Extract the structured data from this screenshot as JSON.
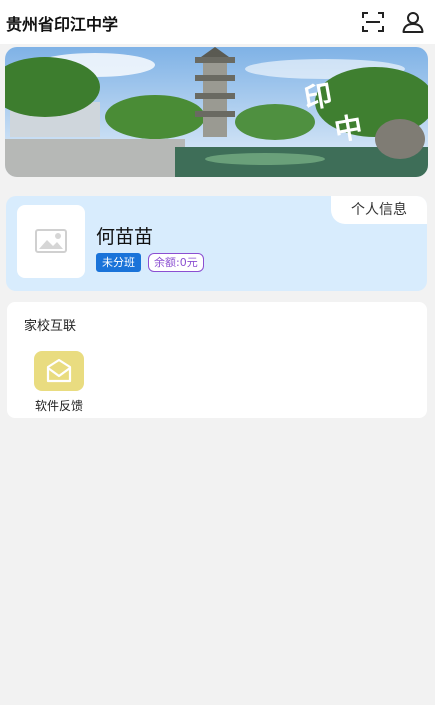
{
  "header": {
    "title": "贵州省印江中学",
    "icons": [
      "scan-icon",
      "user-icon"
    ]
  },
  "banner": {
    "overlay_text": "印中"
  },
  "profile": {
    "tab_label": "个人信息",
    "name": "何苗苗",
    "class_badge": "未分班",
    "balance_badge": "余额:0元"
  },
  "home_school": {
    "title": "家校互联",
    "items": [
      {
        "label": "软件反馈",
        "icon": "mail-icon"
      }
    ]
  },
  "colors": {
    "card_bg": "#d8ecfd",
    "class_badge": "#1a73d9",
    "balance_badge": "#8b4fd1",
    "feedback_tile": "#e9dc80"
  }
}
